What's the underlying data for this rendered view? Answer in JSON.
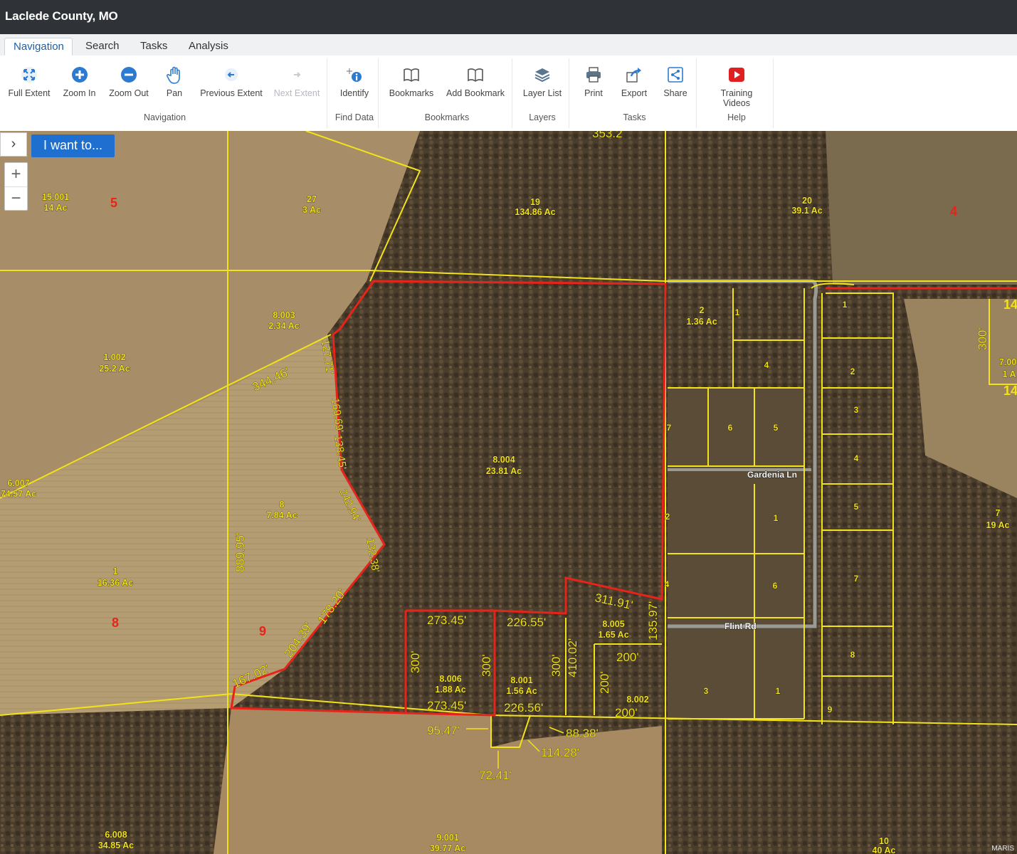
{
  "app": {
    "title": "Laclede County, MO"
  },
  "tabs": [
    "Navigation",
    "Search",
    "Tasks",
    "Analysis"
  ],
  "ribbon": {
    "groups": {
      "navigation": "Navigation",
      "find_data": "Find Data",
      "bookmarks": "Bookmarks",
      "layers": "Layers",
      "tasks": "Tasks",
      "help": "Help"
    },
    "buttons": {
      "full_extent": "Full Extent",
      "zoom_in": "Zoom In",
      "zoom_out": "Zoom Out",
      "pan": "Pan",
      "previous_extent": "Previous Extent",
      "next_extent": "Next Extent",
      "identify": "Identify",
      "bookmarks": "Bookmarks",
      "add_bookmark": "Add Bookmark",
      "layer_list": "Layer List",
      "print": "Print",
      "export": "Export",
      "share": "Share",
      "training_videos": "Training Videos"
    }
  },
  "map_controls": {
    "i_want_to": "I want to...",
    "zoom_in": "+",
    "zoom_out": "−",
    "panel_toggle": "›"
  },
  "colors": {
    "parcel_line": "#f2e21a",
    "subject_parcel": "#e8231a",
    "section_number": "#e8231a",
    "ribbon_accent": "#1f5fa6",
    "i_want_button": "#1e6fd0"
  },
  "map": {
    "parcels": [
      {
        "id": "15.001",
        "acres": "14 Ac"
      },
      {
        "id": "27",
        "acres": "3 Ac"
      },
      {
        "id": "19",
        "acres": "134.86 Ac"
      },
      {
        "id": "20",
        "acres": "39.1 Ac"
      },
      {
        "id": "8.003",
        "acres": "2.34 Ac"
      },
      {
        "id": "1.002",
        "acres": "25.2 Ac"
      },
      {
        "id": "2",
        "acres": "1.36 Ac"
      },
      {
        "id": "8.004",
        "acres": "23.81 Ac"
      },
      {
        "id": "8",
        "acres": "7.84 Ac"
      },
      {
        "id": "6.007",
        "acres": "74.57 Ac"
      },
      {
        "id": "1",
        "acres": "16.36 Ac"
      },
      {
        "id": "7",
        "acres": "19 Ac"
      },
      {
        "id": "8.005",
        "acres": "1.65 Ac"
      },
      {
        "id": "8.006",
        "acres": "1.88 Ac"
      },
      {
        "id": "8.001",
        "acres": "1.56 Ac"
      },
      {
        "id": "8.002",
        "acres": ""
      },
      {
        "id": "6.008",
        "acres": "34.85 Ac"
      },
      {
        "id": "9.001",
        "acres": "39.77 Ac"
      },
      {
        "id": "10",
        "acres": "40 Ac"
      },
      {
        "id": "7.00",
        "acres": "1 A"
      }
    ],
    "sections": [
      "5",
      "4",
      "8",
      "9",
      "14",
      "14"
    ],
    "dimensions": [
      "344.46'",
      "127.71'",
      "169.69'",
      "138.45'",
      "242.94'",
      "132.38'",
      "178.20'",
      "204.39'",
      "167.02'",
      "889.95'",
      "273.45'",
      "273.45'",
      "226.55'",
      "226.56'",
      "300'",
      "300'",
      "300'",
      "410.02'",
      "311.91'",
      "135.97'",
      "200'",
      "200'",
      "200'",
      "95.47'",
      "88.38'",
      "114.28'",
      "72.41'",
      "300'",
      "353.2"
    ],
    "roads": [
      "Gardenia Ln",
      "Flint Rd"
    ],
    "lots_east": [
      "1",
      "2",
      "3",
      "4",
      "5",
      "7",
      "8",
      "9"
    ],
    "lots_west": [
      "1",
      "4",
      "5",
      "6",
      "7",
      "2",
      "1",
      "6",
      "3",
      "1",
      "4"
    ],
    "watermark": "MARIS"
  }
}
